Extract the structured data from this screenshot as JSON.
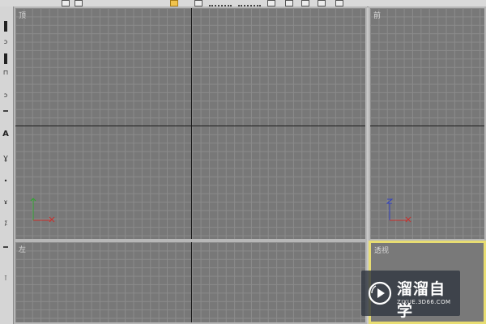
{
  "toolbar": {
    "icons": [
      "toolbar-icon-1",
      "toolbar-icon-2",
      "select-arrow-icon",
      "toolbar-icon-3",
      "snap-dots-icon",
      "snap-dots-icon",
      "toolbar-icon-4",
      "toolbar-icon-5",
      "toolbar-icon-6",
      "toolbar-icon-7",
      "toolbar-icon-8"
    ],
    "selected_color": "#f1c34c"
  },
  "left_toolbar": {
    "icons": [
      "line-icon",
      "lasso-icon",
      "hand-icon",
      "key-icon",
      "curve-icon",
      "cursor-icon",
      "text-icon",
      "rotate-icon",
      "scale-icon",
      "paint-icon",
      "move-icon",
      "pencil-icon",
      "bone-icon"
    ]
  },
  "viewports": {
    "top": {
      "label": "顶"
    },
    "front": {
      "label": "前"
    },
    "left": {
      "label": "左"
    },
    "perspective": {
      "label": "透视"
    }
  },
  "colors": {
    "viewport_bg": "#787878",
    "grid_line": "#8b8b8b",
    "axis_line": "#151515",
    "active_border": "#e8dd72",
    "axis_x": "#c9302c",
    "axis_y": "#2fa22f",
    "axis_z": "#3040c0"
  },
  "watermark": {
    "brand": "溜溜自学",
    "url": "ZIXUE.3D66.COM"
  }
}
